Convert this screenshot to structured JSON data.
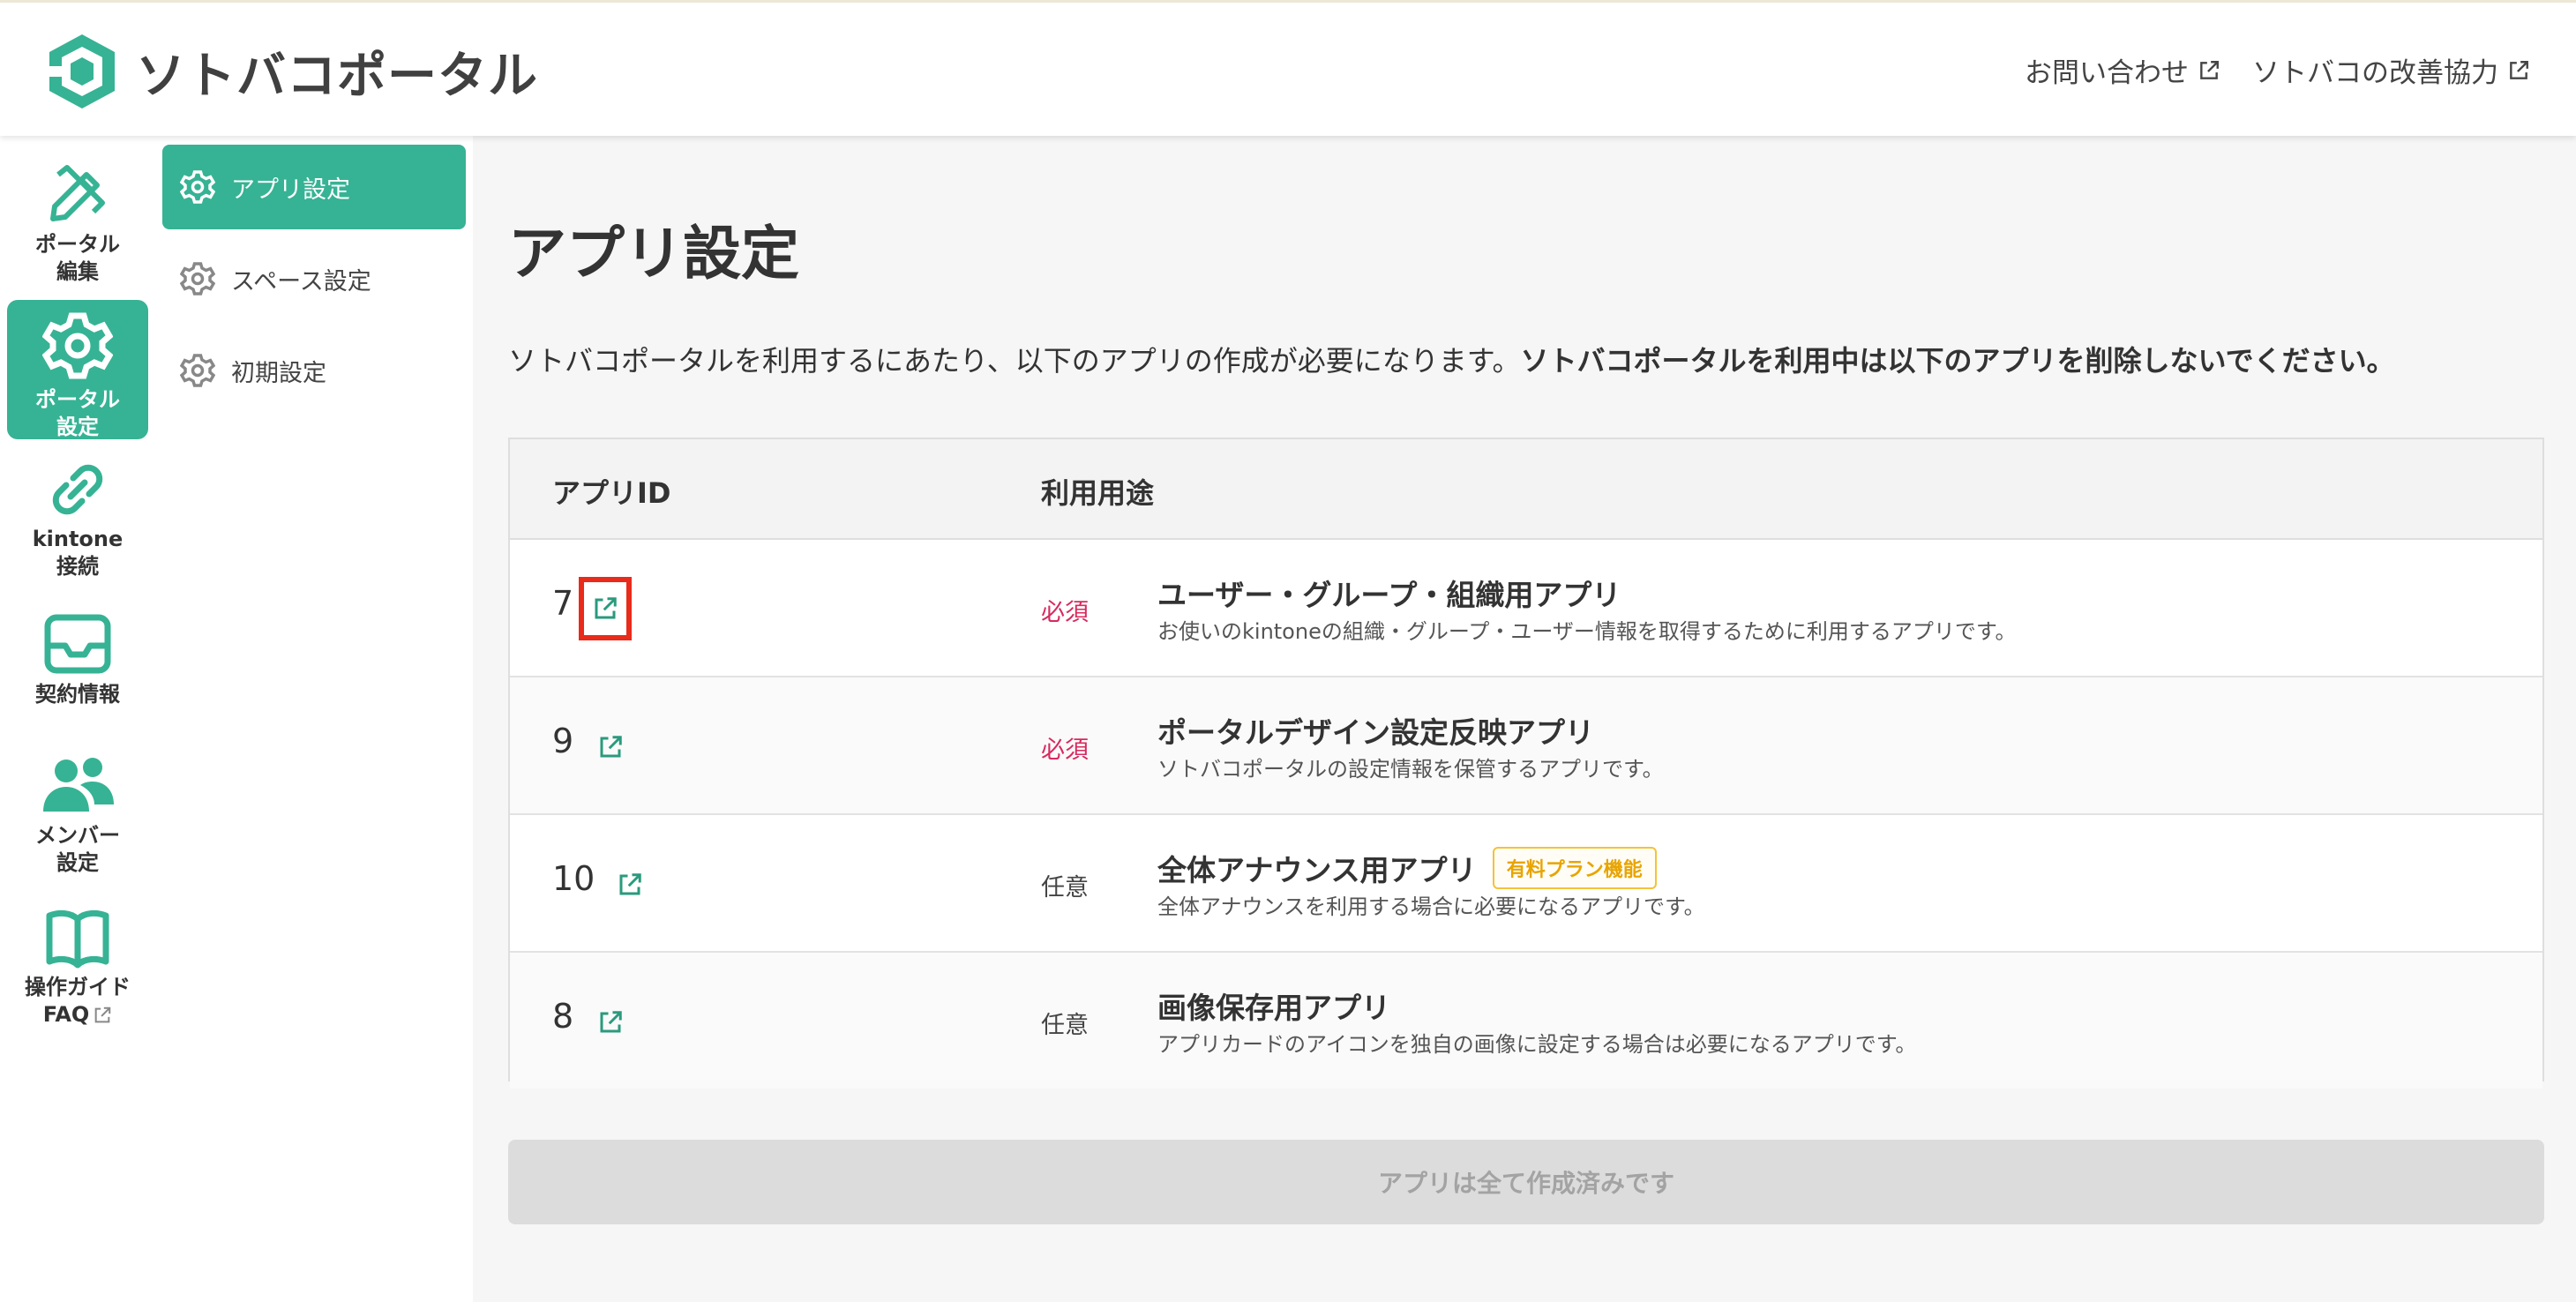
{
  "header": {
    "logo_text": "ソトバコポータル",
    "links": [
      {
        "label": "お問い合わせ",
        "icon": "external-link-icon"
      },
      {
        "label": "ソトバコの改善協力",
        "icon": "external-link-icon"
      }
    ]
  },
  "rail": {
    "items": [
      {
        "line1": "ポータル",
        "line2": "編集",
        "icon": "pencil-ruler-icon",
        "active": false
      },
      {
        "line1": "ポータル",
        "line2": "設定",
        "icon": "gear-icon",
        "active": true
      },
      {
        "line1": "kintone",
        "line2": "接続",
        "icon": "link-icon",
        "active": false
      },
      {
        "line1": "契約情報",
        "line2": "",
        "icon": "inbox-icon",
        "active": false
      },
      {
        "line1": "メンバー",
        "line2": "設定",
        "icon": "users-icon",
        "active": false
      },
      {
        "line1": "操作ガイド",
        "line2": "FAQ",
        "icon": "book-icon",
        "active": false
      }
    ]
  },
  "subnav": {
    "items": [
      {
        "label": "アプリ設定",
        "icon": "gear-icon",
        "active": true
      },
      {
        "label": "スペース設定",
        "icon": "gear-icon",
        "active": false
      },
      {
        "label": "初期設定",
        "icon": "gear-icon",
        "active": false
      }
    ]
  },
  "main": {
    "title": "アプリ設定",
    "description": "ソトバコポータルを利用するにあたり、以下のアプリの作成が必要になります。",
    "description_bold": "ソトバコポータルを利用中は以下のアプリを削除しないでください。",
    "table": {
      "headers": [
        "アプリID",
        "利用用途"
      ],
      "rows": [
        {
          "id": "7",
          "requirement": "必須",
          "name": "ユーザー・グループ・組織用アプリ",
          "badge": "",
          "description": "お使いのkintoneの組織・グループ・ユーザー情報を取得するために利用するアプリです。"
        },
        {
          "id": "9",
          "requirement": "必須",
          "name": "ポータルデザイン設定反映アプリ",
          "badge": "",
          "description": "ソトバコポータルの設定情報を保管するアプリです。"
        },
        {
          "id": "10",
          "requirement": "任意",
          "name": "全体アナウンス用アプリ",
          "badge": "有料プラン機能",
          "description": "全体アナウンスを利用する場合に必要になるアプリです。"
        },
        {
          "id": "8",
          "requirement": "任意",
          "name": "画像保存用アプリ",
          "badge": "",
          "description": "アプリカードのアイコンを独自の画像に設定する場合は必要になるアプリです。"
        }
      ]
    },
    "done_button_label": "アプリは全て作成済みです"
  },
  "colors": {
    "brand": "#36b394",
    "required": "#d72a5e",
    "badge": "#e8a400",
    "highlight": "#e82b1a"
  }
}
